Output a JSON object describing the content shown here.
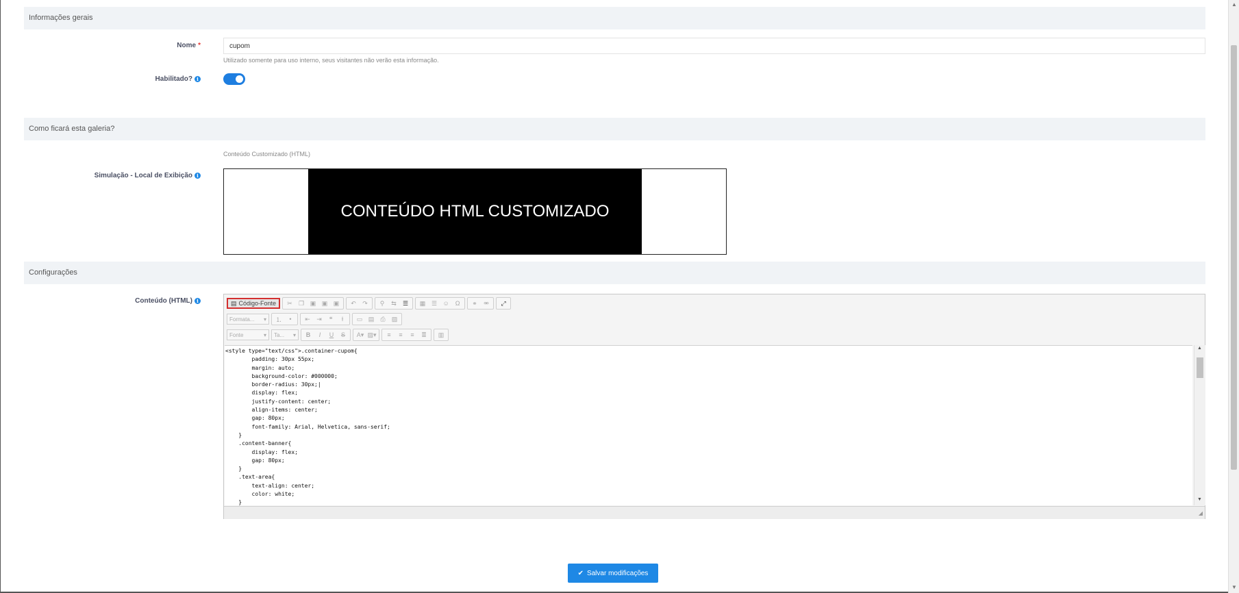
{
  "sections": {
    "general": "Informações gerais",
    "preview": "Como ficará esta galeria?",
    "settings": "Configurações"
  },
  "fields": {
    "name_label": "Nome",
    "required_mark": "*",
    "name_value": "cupom",
    "name_help": "Utilizado somente para uso interno, seus visitantes não verão esta informação.",
    "enabled_label": "Habilitado?",
    "enabled": true,
    "content_type": "Conteúdo Customizado (HTML)",
    "simulation_label": "Simulação - Local de Exibição",
    "simulation_text": "CONTEÚDO HTML CUSTOMIZADO",
    "content_label": "Conteúdo (HTML)"
  },
  "editor": {
    "source_button": "Código-Fonte",
    "format_combo": "Formata...",
    "font_combo": "Fonte",
    "size_combo": "Ta...",
    "code": "<style type=\"text/css\">.container-cupom{\n        padding: 30px 55px;\n        margin: auto;\n        background-color: #000000;\n        border-radius: 30px;|\n        display: flex;\n        justify-content: center;\n        align-items: center;\n        gap: 80px;\n        font-family: Arial, Helvetica, sans-serif;\n    }\n    .content-banner{\n        display: flex;\n        gap: 80px;\n    }\n    .text-area{\n        text-align: center;\n        color: white;\n    }"
  },
  "actions": {
    "save": "Salvar modificações"
  },
  "colors": {
    "accent": "#1e88e5",
    "highlight_border": "#d32f2f"
  }
}
